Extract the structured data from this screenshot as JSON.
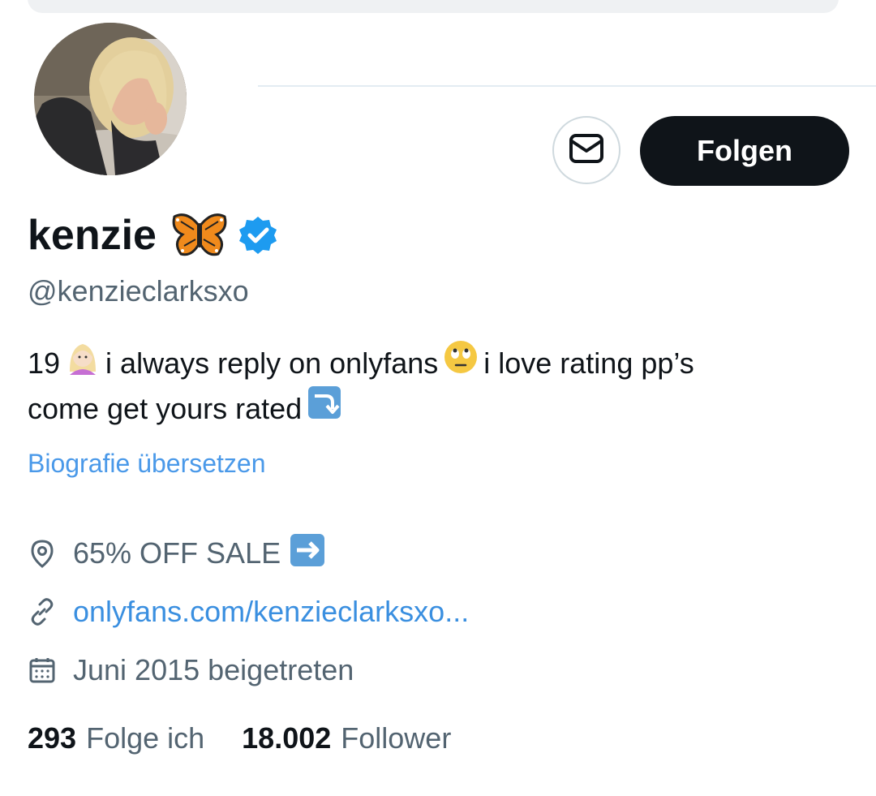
{
  "profile": {
    "display_name": "kenzie",
    "handle": "@kenzieclarksxo",
    "name_emoji_icon": "butterfly-icon",
    "verified_icon": "verified-badge-icon"
  },
  "actions": {
    "message_icon": "envelope-icon",
    "follow_label": "Folgen"
  },
  "bio": {
    "line1_a": "19",
    "line1_b": "i always reply on onlyfans",
    "line1_c": "i love rating pp’s",
    "line2_a": "come get yours rated",
    "emojis": [
      "woman-light-skin-blond-emoji",
      "face-with-rolling-eyes-emoji",
      "right-arrow-curving-down-emoji"
    ]
  },
  "translate_label": "Biografie übersetzen",
  "meta": {
    "location": "65% OFF SALE",
    "location_icon": "location-pin-icon",
    "location_emoji": "right-arrow-emoji",
    "url": "onlyfans.com/kenzieclarksxo...",
    "url_icon": "link-icon",
    "joined": "Juni 2015 beigetreten",
    "joined_icon": "calendar-icon"
  },
  "stats": {
    "following_count": "293",
    "following_label": "Folge ich",
    "followers_count": "18.002",
    "followers_label": "Follower"
  },
  "colors": {
    "text": "#0f1419",
    "secondary": "#536471",
    "link": "#4a99e9",
    "verified": "#1d9bf0",
    "button_bg": "#0f1419"
  }
}
